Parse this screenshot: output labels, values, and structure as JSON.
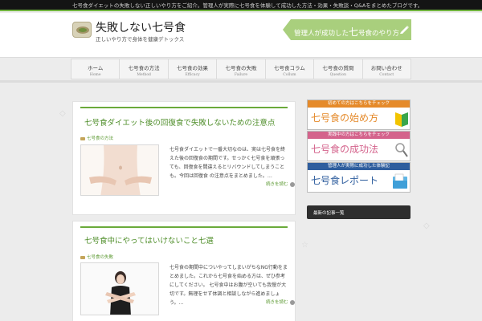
{
  "topbar": {
    "text": "七号食ダイエットの失敗しない正しいやり方をご紹介。管理人が実際に七号食を体験して成功した方法・効果・失敗談・Q&Aをまとめたブログです。"
  },
  "header": {
    "title": "失敗しない七号食",
    "subtitle": "正しいやり方で身体を健康デトックス",
    "banner_prefix": "管理人が成功した",
    "banner_highlight": "七",
    "banner_suffix": "号食のやり方"
  },
  "nav": [
    {
      "jp": "ホーム",
      "en": "Home"
    },
    {
      "jp": "七号食の方法",
      "en": "Method"
    },
    {
      "jp": "七号食の効果",
      "en": "Efficacy"
    },
    {
      "jp": "七号食の失敗",
      "en": "Failure"
    },
    {
      "jp": "七号食コラム",
      "en": "Collum"
    },
    {
      "jp": "七号食の質問",
      "en": "Question"
    },
    {
      "jp": "お問い合わせ",
      "en": "Contact"
    }
  ],
  "posts": [
    {
      "title": "七号食ダイエット後の回復食で失敗しないための注意点",
      "category": "七号食の方法",
      "excerpt": "七号食ダイエットで一番大切なのは、実は七号食を終えた後の回復食の期間です。せっかく七号食を頑張っても、回復食を間違えるとリバウンドしてしまうことも。今回は回復食 の注意点をまとめました。…",
      "more": "続きを読む"
    },
    {
      "title": "七号食中にやってはいけないこと七選",
      "category": "七号食の失敗",
      "excerpt": "七号食の期間中についやってしまいがちなNG行動をまとめました。これから七号食を始める方は、ぜひ参考にしてください。 七号食中はお腹が空いても我慢が大切です。無理をせず体調と相談しながら進めましょう。…",
      "more": "続きを読む"
    }
  ],
  "sidebar": {
    "panels": [
      {
        "head": "初めての方はこちらをチェック",
        "body": "七号食の始め方",
        "head_color": "#e58a2a",
        "body_color": "#e58a2a"
      },
      {
        "head": "実践中の方はこちらをチェック",
        "body": "七号食の成功法",
        "head_color": "#d4638c",
        "body_color": "#d4638c"
      },
      {
        "head": "管理人が実際に成功した体験記",
        "body": "七号食レポート",
        "head_color": "#2f5e9e",
        "body_color": "#2f5e9e"
      }
    ],
    "widget_title": "最新の記事一覧"
  }
}
